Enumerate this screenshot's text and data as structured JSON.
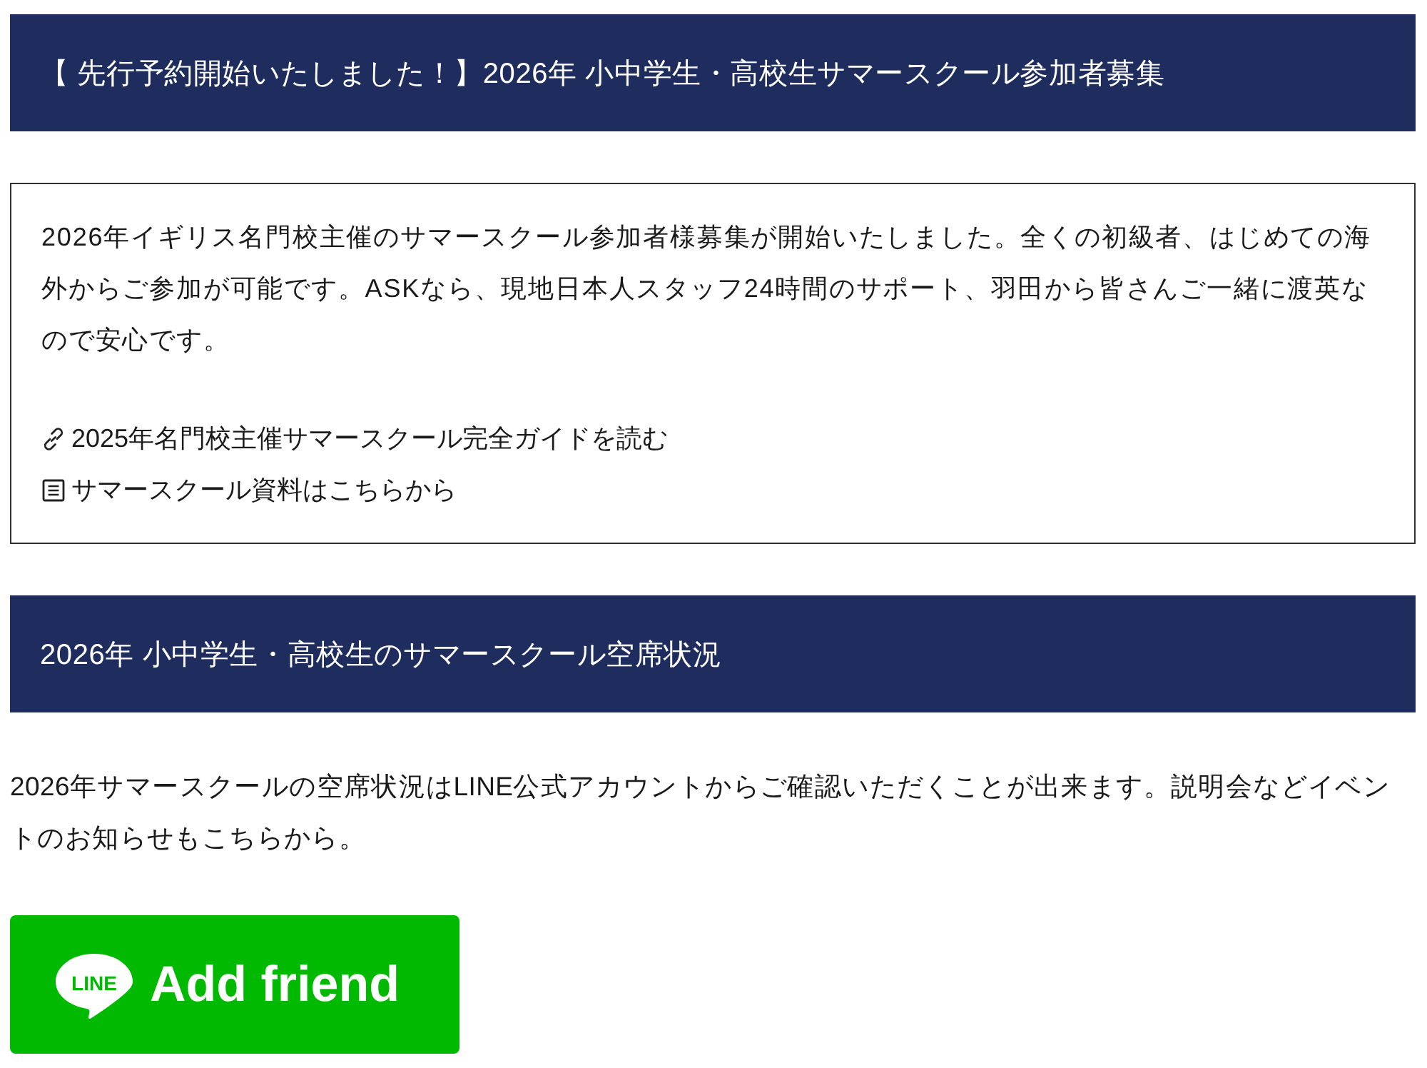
{
  "announcement": {
    "heading": "【 先行予約開始いたしました！】2026年 小中学生・高校生サマースクール参加者募集",
    "body": "2026年イギリス名門校主催のサマースクール参加者様募集が開始いたしました。全くの初級者、はじめての海外からご参加が可能です。ASKなら、現地日本人スタッフ24時間のサポート、羽田から皆さんご一緒に渡英なので安心です。",
    "links": [
      {
        "kind": "link",
        "label": "2025年名門校主催サマースクール完全ガイドを読む"
      },
      {
        "kind": "document",
        "label": "サマースクール資料はこちらから"
      }
    ]
  },
  "availability": {
    "heading": "2026年 小中学生・高校生のサマースクール空席状況",
    "body": "2026年サマースクールの空席状況はLINE公式アカウントからご確認いただくことが出来ます。説明会などイベントのお知らせもこちらから。",
    "line_button": {
      "logo_text": "LINE",
      "label": "Add friend"
    }
  }
}
